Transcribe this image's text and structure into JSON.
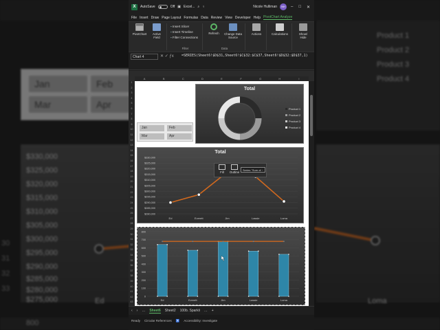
{
  "background": {
    "slicers": [
      "Jan",
      "Feb",
      "Mar",
      "Apr"
    ],
    "y_labels": [
      "$330,000",
      "$325,000",
      "$320,000",
      "$315,000",
      "$310,000",
      "$305,000",
      "$300,000",
      "$295,000",
      "$290,000",
      "$285,000",
      "$280,000",
      "$275,000"
    ],
    "legend": [
      "Product 1",
      "Product 2",
      "Product 3",
      "Product 4"
    ],
    "x_labels": [
      "Ed",
      "Loma"
    ],
    "bottom_value": "800",
    "row_numbers": [
      "30",
      "31",
      "32",
      "33",
      "34",
      "35",
      "36",
      "37",
      "38",
      "39",
      "40",
      "41",
      "42",
      "43"
    ]
  },
  "titlebar": {
    "autosave": "AutoSave",
    "toggle_state": "Off",
    "file_name": "Excel...",
    "user": "Nicole Hulliman",
    "initials": "NH"
  },
  "ribbon_tabs": [
    "File",
    "Insert",
    "Draw",
    "Page Layout",
    "Formulas",
    "Data",
    "Review",
    "View",
    "Developer",
    "Help",
    "PivotChart Analyze"
  ],
  "active_tab": "PivotChart Analyze",
  "ribbon": {
    "pivotchart": "PivotChart",
    "active_field": "Active Field",
    "filter_items": [
      "Insert Slicer",
      "Insert Timeline",
      "Filter Connections"
    ],
    "filter_group": "Filter",
    "refresh": "Refresh",
    "change_source": "Change Data Source",
    "data_group": "Data",
    "actions": "Actions",
    "calculations": "Calculations",
    "show_hide": "Show/ Hide"
  },
  "formula_bar": {
    "name_box": "Chart 4",
    "formula": "=SERIES(Sheet6!$D$31,Sheet6!$C$32:$C$37,Sheet6!$D$32:$D$37,1)"
  },
  "columns": [
    "A",
    "B",
    "C",
    "D",
    "E",
    "F",
    "G",
    "H",
    "I"
  ],
  "rows": [
    "1",
    "2",
    "3",
    "4",
    "5",
    "6",
    "7",
    "8",
    "9",
    "10",
    "11",
    "12",
    "13",
    "14",
    "15",
    "16",
    "17",
    "18",
    "19",
    "20",
    "21",
    "22",
    "23",
    "24",
    "25",
    "26",
    "27",
    "28",
    "29",
    "30",
    "31",
    "32",
    "33",
    "34",
    "35",
    "36",
    "37",
    "38",
    "39",
    "40",
    "41",
    "42",
    "43"
  ],
  "slicer": {
    "items": [
      "Jan",
      "Feb",
      "Mar",
      "Apr"
    ]
  },
  "donut_chart": {
    "title": "Total",
    "legend": [
      "Product 1",
      "Product 2",
      "Product 3",
      "Product 4"
    ],
    "colors": [
      "#2a2a2a",
      "#9a9a9a",
      "#c8c8c8",
      "#e8e8e8"
    ]
  },
  "chart_data": [
    {
      "type": "pie",
      "title": "Total",
      "categories": [
        "Product 1",
        "Product 2",
        "Product 3",
        "Product 4"
      ],
      "values": [
        25,
        25,
        25,
        25
      ]
    },
    {
      "type": "line",
      "title": "Total",
      "categories": [
        "Ed",
        "Everett",
        "Jim",
        "Lassie",
        "Loma"
      ],
      "values": [
        290000,
        297000,
        317000,
        313000,
        291000
      ],
      "ylim": [
        280000,
        330000
      ],
      "y_ticks": [
        "$330,000",
        "$325,000",
        "$320,000",
        "$315,000",
        "$310,000",
        "$305,000",
        "$300,000",
        "$295,000",
        "$290,000",
        "$285,000",
        "$280,000"
      ],
      "line_color": "#d2691e"
    },
    {
      "type": "bar",
      "categories": [
        "Ed",
        "Everett",
        "Jim",
        "Lassie",
        "Loma"
      ],
      "values": [
        640,
        570,
        680,
        560,
        520
      ],
      "line_values": [
        680,
        680,
        680,
        680,
        680
      ],
      "ylim": [
        0,
        800
      ],
      "y_ticks": [
        "800",
        "700",
        "600",
        "500",
        "400",
        "300",
        "200",
        "100",
        "0"
      ],
      "bar_color": "#2e86a8",
      "line_color": "#d2691e"
    }
  ],
  "format_popup": {
    "fill": "Fill",
    "outline": "Outline",
    "series": "Series \"Sum of ~"
  },
  "sheet_tabs": [
    "Sheet6",
    "Sheet2",
    "100b. Sparkli"
  ],
  "active_sheet": "Sheet6",
  "status": {
    "ready": "Ready",
    "circular": "Circular References",
    "accessibility": "Accessibility: Investigate"
  }
}
